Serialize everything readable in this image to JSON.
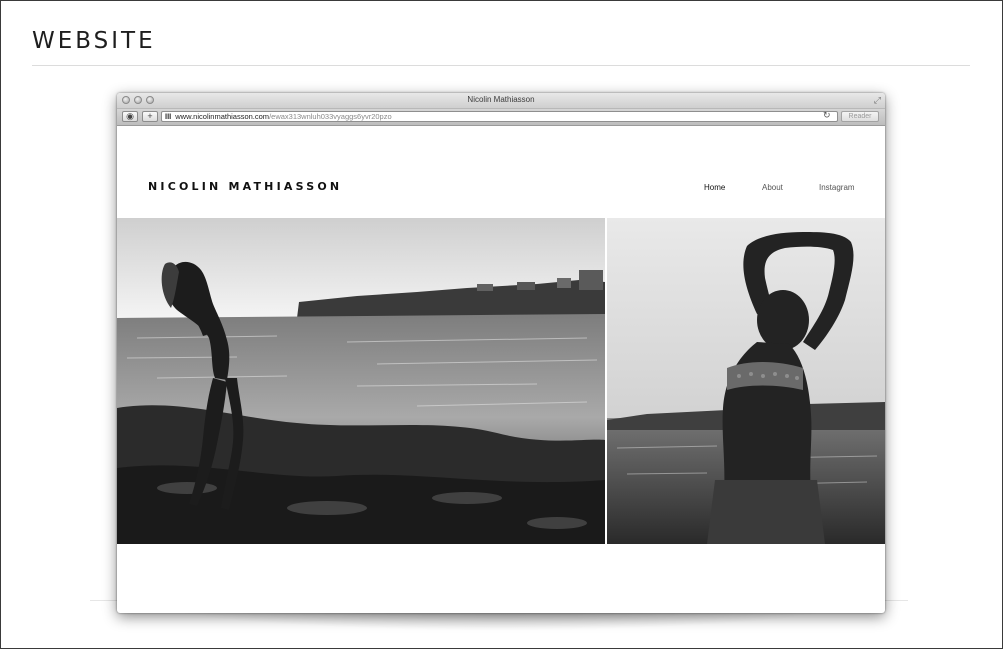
{
  "page": {
    "section_title": "WEBSITE"
  },
  "browser": {
    "window_title": "Nicolin Mathiasson",
    "url_host": "www.nicolinmathiasson.com",
    "url_path": "/ewax313wnluh033vyaggs6yvr20pzo",
    "reader_label": "Reader",
    "add_tab_label": "+"
  },
  "site": {
    "logo_text": "NICOLIN MATHIASSON",
    "nav": [
      {
        "label": "Home"
      },
      {
        "label": "About"
      },
      {
        "label": "Instagram"
      }
    ]
  },
  "icons": {
    "traffic_lights": [
      "close-icon",
      "minimize-icon",
      "zoom-icon"
    ],
    "reload": "reload-icon",
    "share": "share-icon",
    "fullscreen": "fullscreen-icon"
  }
}
